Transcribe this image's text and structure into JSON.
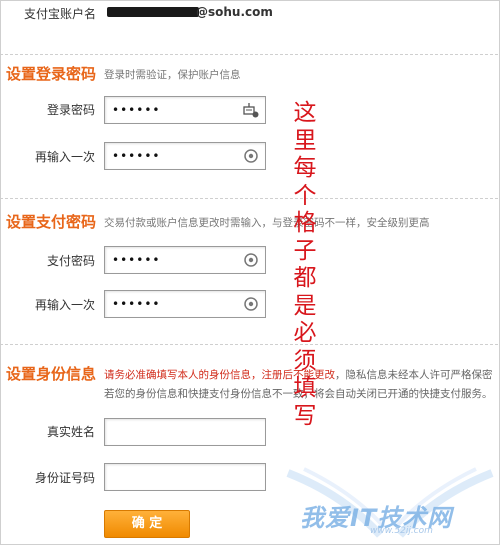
{
  "account": {
    "label": "支付宝账户名",
    "email_suffix": "@sohu.com"
  },
  "login_password": {
    "title": "设置登录密码",
    "hint": "登录时需验证，保护账户信息",
    "fields": [
      {
        "label": "登录密码",
        "value": "••••••",
        "icon": "keyboard-icon"
      },
      {
        "label": "再输入一次",
        "value": "••••••",
        "icon": "security-control-icon"
      }
    ]
  },
  "pay_password": {
    "title": "设置支付密码",
    "hint": "交易付款或账户信息更改时需输入，与登录密码不一样，安全级别更高",
    "fields": [
      {
        "label": "支付密码",
        "value": "••••••",
        "icon": "security-control-icon"
      },
      {
        "label": "再输入一次",
        "value": "••••••",
        "icon": "security-control-icon"
      }
    ]
  },
  "identity": {
    "title": "设置身份信息",
    "notice_red": "请务必准确填写本人的身份信息，注册后不能更改",
    "notice_gray_1": "，隐私信息未经本人许可严格保密",
    "notice_gray_2": "若您的身份信息和快捷支付身份信息不一致，将会自动关闭已开通的快捷支付服务。",
    "fields": [
      {
        "label": "真实姓名",
        "value": "",
        "placeholder": ""
      },
      {
        "label": "身份证号码",
        "value": "",
        "placeholder": ""
      }
    ]
  },
  "submit": {
    "label": "确 定"
  },
  "annotation": {
    "chars": [
      "这",
      "里",
      "每",
      "个",
      "格",
      "子",
      "都",
      "是",
      "必",
      "须",
      "填",
      "写"
    ]
  },
  "watermark": {
    "text": "我爱IT技术网",
    "url": "www.52ij.com"
  },
  "colors": {
    "accent": "#e8661a",
    "annotation": "#d8161c",
    "button": "#f08a00"
  }
}
